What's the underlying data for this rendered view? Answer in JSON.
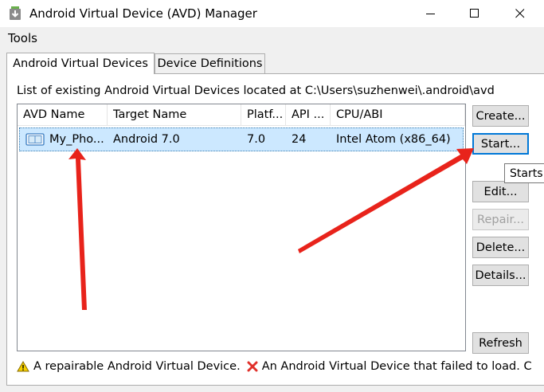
{
  "window": {
    "title": "Android Virtual Device (AVD) Manager",
    "controls": [
      "minimize",
      "maximize",
      "close"
    ]
  },
  "menu": {
    "items": [
      "Tools"
    ]
  },
  "tabs": [
    {
      "label": "Android Virtual Devices",
      "selected": true
    },
    {
      "label": "Device Definitions",
      "selected": false
    }
  ],
  "list_caption": "List of existing Android Virtual Devices located at C:\\Users\\suzhenwei\\.android\\avd",
  "table": {
    "columns": [
      "AVD Name",
      "Target Name",
      "Platf...",
      "API ...",
      "CPU/ABI"
    ],
    "rows": [
      {
        "avd_name": "My_Pho...",
        "target_name": "Android 7.0",
        "platform": "7.0",
        "api": "24",
        "cpu_abi": "Intel Atom (x86_64)",
        "selected": true
      }
    ]
  },
  "buttons": {
    "create": "Create...",
    "start": "Start...",
    "edit": "Edit...",
    "repair": "Repair...",
    "delete": "Delete...",
    "details": "Details...",
    "refresh": "Refresh"
  },
  "tooltip": "Starts",
  "legend": {
    "repairable": "A repairable Android Virtual Device.",
    "failed": "An Android Virtual Device that failed to load. C"
  },
  "colors": {
    "selection": "#cce8ff",
    "annotation_arrow": "#e8231b",
    "focus_border": "#0078d7"
  }
}
